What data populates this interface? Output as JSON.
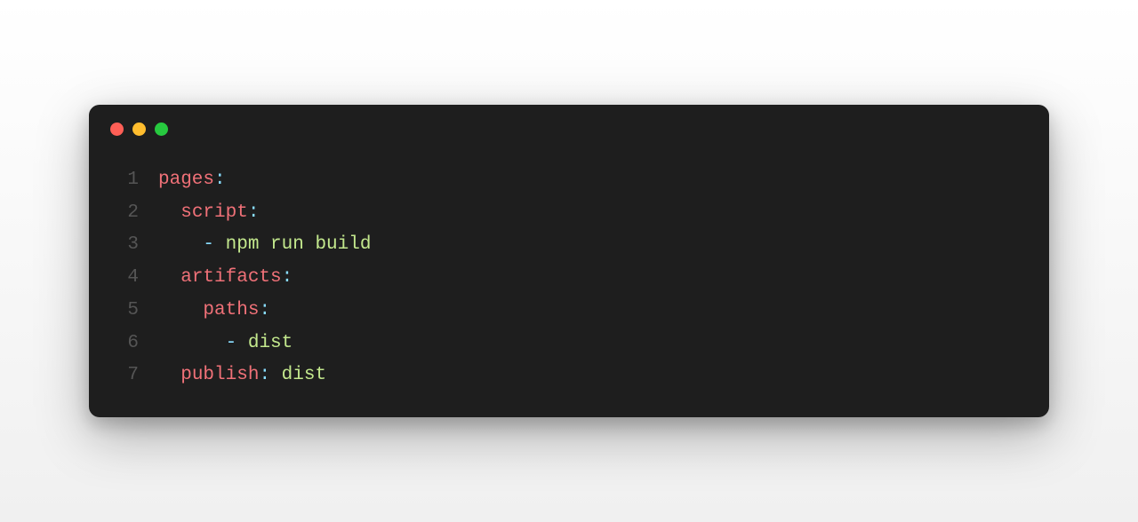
{
  "window": {
    "dots": {
      "red": "#ff5f56",
      "yellow": "#ffbd2e",
      "green": "#27c93f"
    }
  },
  "lines": {
    "l1_num": "1",
    "l1_key": "pages",
    "l2_num": "2",
    "l2_indent": "  ",
    "l2_key": "script",
    "l3_num": "3",
    "l3_indent": "    ",
    "l3_dash": "-",
    "l3_val": " npm run build",
    "l4_num": "4",
    "l4_indent": "  ",
    "l4_key": "artifacts",
    "l5_num": "5",
    "l5_indent": "    ",
    "l5_key": "paths",
    "l6_num": "6",
    "l6_indent": "      ",
    "l6_dash": "-",
    "l6_val": " dist",
    "l7_num": "7",
    "l7_indent": "  ",
    "l7_key": "publish",
    "l7_sep": ": ",
    "l7_val": "dist"
  }
}
